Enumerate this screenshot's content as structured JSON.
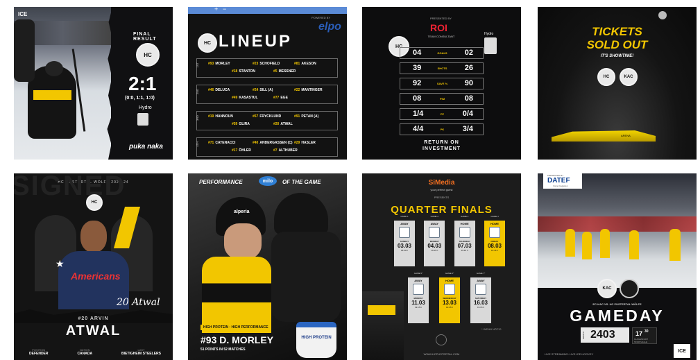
{
  "tiles": {
    "t1": {
      "top_logo": "ICE",
      "final_result": "FINAL RESULT",
      "score": "2:1",
      "periods": "(0:0, 1:1, 1:0)",
      "partner": "puka naka",
      "hydro": "Hydro",
      "colors": {
        "accent": "#f2c600",
        "bg": "#0f0f10"
      }
    },
    "t2": {
      "title": "LINEUP",
      "sponsor": "elpo",
      "powered": "POWERED BY",
      "lines": [
        {
          "label": "1ST",
          "top": [
            {
              "num": "#93",
              "name": "MORLEY"
            },
            {
              "num": "#23",
              "name": "SCHOFIELD"
            },
            {
              "num": "#81",
              "name": "AKESON"
            }
          ],
          "bottom": [
            {
              "num": "#18",
              "name": "STANTON"
            },
            {
              "num": "#5",
              "name": "MESSNER"
            }
          ]
        },
        {
          "label": "2ND",
          "top": [
            {
              "num": "#46",
              "name": "DELUCA"
            },
            {
              "num": "#24",
              "name": "SILL (A)"
            },
            {
              "num": "#22",
              "name": "MANTINGER"
            }
          ],
          "bottom": [
            {
              "num": "#49",
              "name": "KASASTUL"
            },
            {
              "num": "#77",
              "name": "EGE"
            }
          ]
        },
        {
          "label": "3RD",
          "top": [
            {
              "num": "#19",
              "name": "HANNOUN"
            },
            {
              "num": "#67",
              "name": "FRYCKLUND"
            },
            {
              "num": "#91",
              "name": "PETAN (A)"
            }
          ],
          "bottom": [
            {
              "num": "#59",
              "name": "GLIRA"
            },
            {
              "num": "#20",
              "name": "ATWAL"
            }
          ]
        },
        {
          "label": "4TH",
          "top": [
            {
              "num": "#71",
              "name": "CATENACCI"
            },
            {
              "num": "#40",
              "name": "ANDERGASSEN (C)"
            },
            {
              "num": "#29",
              "name": "HASLER"
            }
          ],
          "bottom": [
            {
              "num": "#17",
              "name": "ÖHLER"
            },
            {
              "num": "#7",
              "name": "ALTHUBER"
            }
          ]
        }
      ]
    },
    "t3": {
      "sponsor": "ROI",
      "sponsor_sub": "TEAM CONSULTANT",
      "presented": "PRESENTED BY",
      "stats": [
        {
          "left": "04",
          "label": "GOALS",
          "right": "02"
        },
        {
          "left": "39",
          "label": "SHOTS",
          "right": "26"
        },
        {
          "left": "92",
          "label": "SAVE %",
          "right": "90"
        },
        {
          "left": "08",
          "label": "PIM",
          "right": "08"
        },
        {
          "left": "1/4",
          "label": "PP",
          "right": "0/4"
        },
        {
          "left": "4/4",
          "label": "PK",
          "right": "3/4"
        }
      ],
      "footer_1": "RETURN ON",
      "footer_2": "INVESTMENT",
      "hydro": "Hydro"
    },
    "t4": {
      "line1": "TICKETS",
      "line2": "SOLD OUT",
      "sub": "IT'S SHOWTIME!",
      "arena": "ARENA",
      "team_b": "KAC"
    },
    "t5": {
      "header": "HC PUSTERTAL WÖLFE 2023-24",
      "bg_text": "SIGNED",
      "jersey": "Americans",
      "signature": "20 Atwal",
      "number_name": "#20 ARVIN",
      "last": "ATWAL",
      "facts": [
        {
          "key": "POSITION",
          "val": "DEFENDER"
        },
        {
          "key": "NATION",
          "val": "CANADA"
        },
        {
          "key": "LAST",
          "val": "BIETIGHEIM STEELERS"
        }
      ]
    },
    "t6": {
      "title_left": "PERFORMANCE",
      "brand": "milo",
      "title_right": "OF THE GAME",
      "tagline": "HIGH PROTEIN · HIGH PERFORMANCE",
      "player": "#93 D. MORLEY",
      "stat": "51 POINTS IN 52 MATCHES",
      "product": "HIGH PROTEIN",
      "helmet_brand": "alperia"
    },
    "t7": {
      "sponsor": "SiMedia",
      "sponsor_sub": "your perfect guest",
      "presents": "PRESENTS",
      "title": "QUARTER FINALS",
      "row1": [
        {
          "game": "GAME 1",
          "type": "AWAY",
          "day": "SUNDAY",
          "date": "03.03",
          "time": "18.00 h",
          "home": false
        },
        {
          "game": "GAME 2",
          "type": "AWAY",
          "day": "MONDAY",
          "date": "04.03",
          "time": "19.15 h",
          "home": false
        },
        {
          "game": "GAME 3",
          "type": "HOME",
          "day": "THURSDAY",
          "date": "07.03",
          "time": "19.45 h",
          "home": false
        },
        {
          "game": "GAME 4",
          "type": "HOME",
          "day": "FRIDAY",
          "date": "08.03",
          "time": "19.45 h",
          "home": true
        }
      ],
      "row2": [
        {
          "game": "GAME 5*",
          "type": "AWAY",
          "day": "MONDAY",
          "date": "11.03",
          "time": "19.15 h",
          "home": false
        },
        {
          "game": "GAME 6*",
          "type": "HOME",
          "day": "WEDNESDAY",
          "date": "13.03",
          "time": "19.45 h",
          "home": true
        },
        {
          "game": "GAME 7*",
          "type": "AWAY",
          "day": "SATURDAY",
          "date": "16.03",
          "time": "19.15 h",
          "home": false
        }
      ],
      "note": "* WENN NÖTIG",
      "url": "WWW.HCPUSTERTAL.COM"
    },
    "t8": {
      "sponsor": "DATEF",
      "sponsor_sub": "Immer begleiten",
      "presented": "PRESENTED BY",
      "team_a": "KAC",
      "matchup": "EC-KAC VS. HC PUSTERTAL WÖLFE",
      "title": "GAMEDAY",
      "month": "MARCH",
      "date": "2403",
      "time": "17",
      "time_min": "30",
      "venue": "KLAGENFURT STADTHALLE",
      "footer": "LIVE STREAMING: LIVE.ICE.HOCKEY",
      "ice": "ICE"
    }
  }
}
